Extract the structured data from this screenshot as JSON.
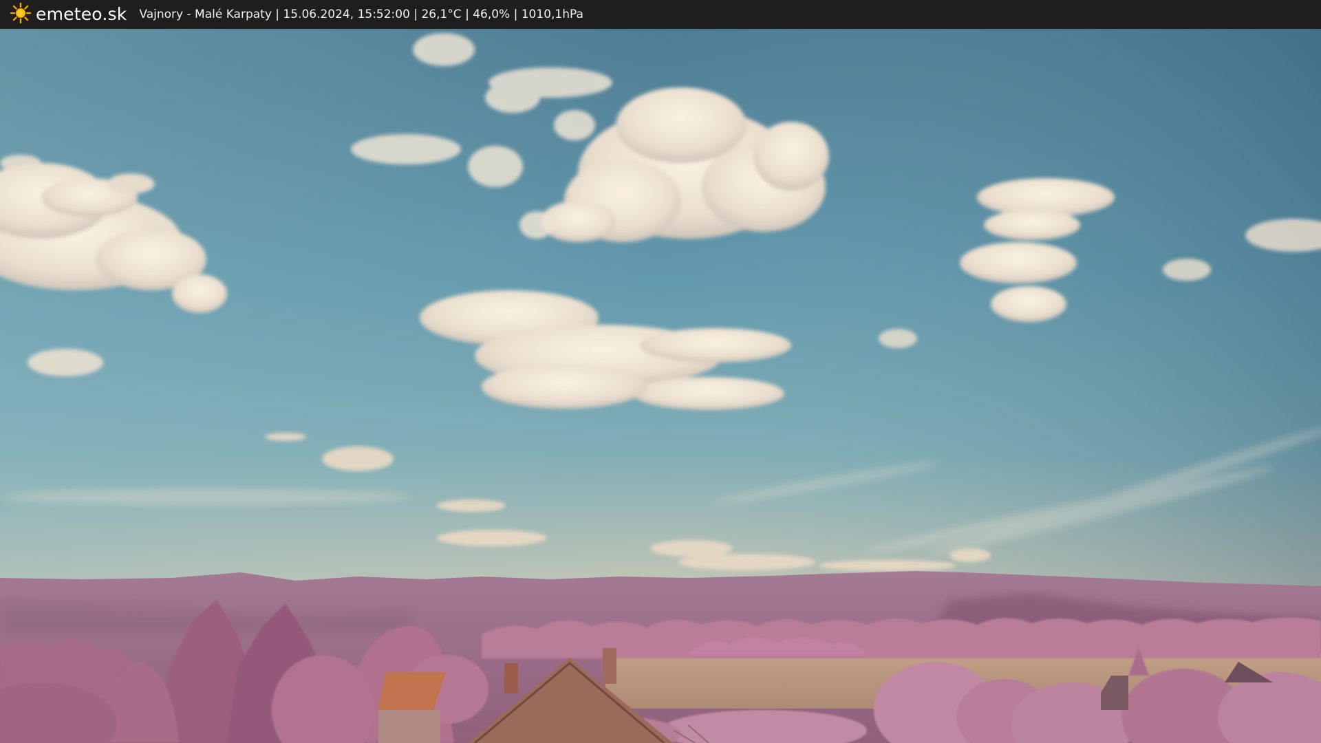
{
  "header": {
    "brand": "emeteo.sk",
    "logo_icon": "sun-icon",
    "caption": "Vajnory - Malé Karpaty | 15.06.2024, 15:52:00 | 26,1°C | 46,0% | 1010,1hPa"
  },
  "colors": {
    "bar": "#1e1e1e",
    "sky_top": "#4f7f95",
    "sky_mid": "#6ea3b2",
    "sky_horizon": "#d7c9b0",
    "hills": "#a8778e",
    "foliage": "#b57a93",
    "field": "#b8957c",
    "roof": "#a0705e",
    "sun": "#f5a200"
  }
}
